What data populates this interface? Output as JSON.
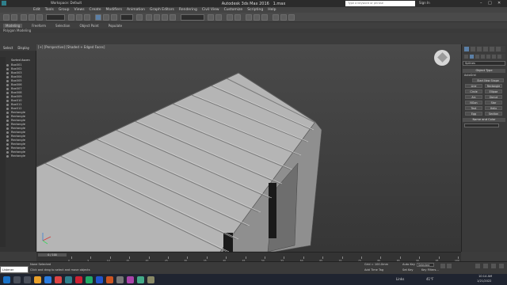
{
  "title": {
    "app_title": "Autodesk 3ds Max 2016",
    "file": "1.max",
    "workspace": "Workspace: Default",
    "search_placeholder": "Type a keyword or phrase",
    "signin": "Sign In"
  },
  "menu": [
    "Edit",
    "Tools",
    "Group",
    "Views",
    "Create",
    "Modifiers",
    "Animation",
    "Graph Editors",
    "Rendering",
    "Civil View",
    "Customize",
    "Scripting",
    "Help"
  ],
  "ribbon": {
    "tabs": [
      "Modeling",
      "Freeform",
      "Selection",
      "Object Paint",
      "Populate"
    ],
    "active": "Modeling",
    "sub": "Polygon Modeling"
  },
  "scene_explorer": {
    "tabs": [
      "Select",
      "Display"
    ],
    "header": "Sorted Ascen",
    "items": [
      "Box001",
      "Box002",
      "Box003",
      "Box004",
      "Box005",
      "Box006",
      "Box007",
      "Box008",
      "Box009",
      "Box010",
      "Box011",
      "Box012",
      "Rectangle",
      "Rectangle",
      "Rectangle",
      "Rectangle",
      "Rectangle",
      "Rectangle",
      "Rectangle",
      "Rectangle",
      "Rectangle",
      "Rectangle",
      "Rectangle",
      "Rectangle"
    ]
  },
  "viewport": {
    "label": "[+] [Perspective] [Shaded + Edged Faces]"
  },
  "command_panel": {
    "category": "Splines",
    "object_type_head": "Object Type",
    "autogrid": "AutoGrid",
    "start_new_shape": "Start New Shape",
    "buttons": [
      "Line",
      "Rectangle",
      "Circle",
      "Ellipse",
      "Arc",
      "Donut",
      "NGon",
      "Star",
      "Text",
      "Helix",
      "Egg",
      "Section"
    ],
    "name_color_head": "Name and Color"
  },
  "timeline": {
    "frame": "0 / 100",
    "ticks": [
      "0",
      "5",
      "10",
      "15",
      "20",
      "25",
      "30",
      "35",
      "40",
      "45",
      "50",
      "55",
      "60",
      "65",
      "70",
      "75",
      "80",
      "85",
      "90",
      "95",
      "100"
    ]
  },
  "status": {
    "maxscript": "Listener",
    "selected": "None Selected",
    "prompt": "Click and drag to select and move objects",
    "grid": "Grid = 100.0mm",
    "add_time_tag": "Add Time Tag",
    "autokey": "Auto Key",
    "selected_label": "Selected",
    "set_key": "Set Key",
    "key_filters": "Key Filters..."
  },
  "taskbar": {
    "links": "Links",
    "temp": "41°F",
    "time": "10:14 AM",
    "date": "1/21/2022"
  },
  "colors": {
    "roof": "#b8b8b8",
    "viewport_bg": "#3d3d3d",
    "accent": "#1a73c9"
  }
}
